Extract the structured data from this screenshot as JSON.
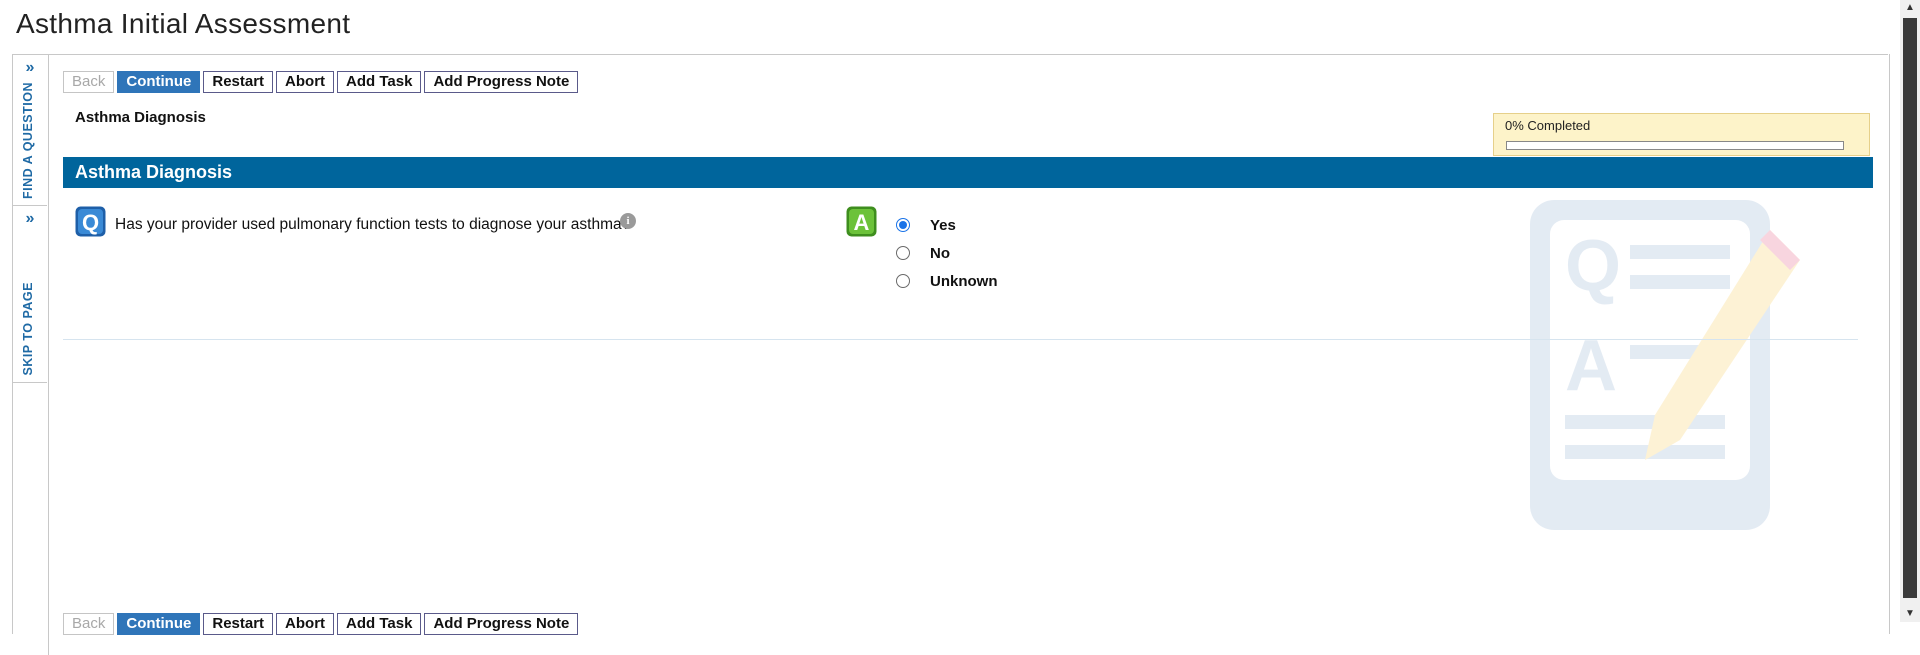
{
  "page": {
    "title": "Asthma Initial Assessment"
  },
  "side_tabs": {
    "find_question": "FIND A QUESTION",
    "skip_to_page": "SKIP TO PAGE",
    "chevron": "»"
  },
  "toolbar": {
    "back": "Back",
    "continue": "Continue",
    "restart": "Restart",
    "abort": "Abort",
    "add_task": "Add Task",
    "add_progress_note": "Add Progress Note"
  },
  "section": {
    "label": "Asthma Diagnosis",
    "header": "Asthma Diagnosis"
  },
  "progress": {
    "text": "0% Completed",
    "value": 0
  },
  "question": {
    "icon": "q-icon",
    "text": "Has your provider used pulmonary function tests to diagnose your asthma?",
    "info_icon": "i"
  },
  "answer": {
    "icon": "a-icon",
    "options": [
      {
        "label": "Yes",
        "checked": true
      },
      {
        "label": "No",
        "checked": false
      },
      {
        "label": "Unknown",
        "checked": false
      }
    ]
  },
  "colors": {
    "accent": "#2f75b9",
    "section_header": "#00659c",
    "progress_bg": "#fdf3c9"
  }
}
